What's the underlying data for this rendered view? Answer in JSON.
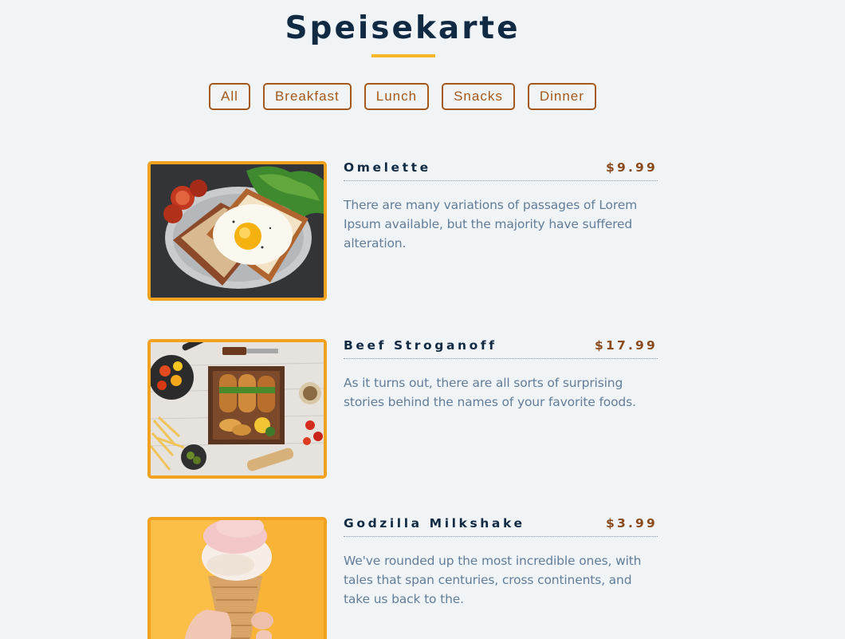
{
  "header": {
    "title": "Speisekarte"
  },
  "filters": [
    {
      "label": "All"
    },
    {
      "label": "Breakfast"
    },
    {
      "label": "Lunch"
    },
    {
      "label": "Snacks"
    },
    {
      "label": "Dinner"
    }
  ],
  "menu": [
    {
      "name": "Omelette",
      "price": "$9.99",
      "description": "There are many variations of passages of Lorem Ipsum available, but the majority have suffered alteration."
    },
    {
      "name": "Beef Stroganoff",
      "price": "$17.99",
      "description": "As it turns out, there are all sorts of surprising stories behind the names of your favorite foods."
    },
    {
      "name": "Godzilla Milkshake",
      "price": "$3.99",
      "description": "We've rounded up the most incredible ones, with tales that span centuries, cross continents, and take us back to the."
    }
  ],
  "colors": {
    "background": "#f1f4f7",
    "title": "#102a43",
    "accent": "#f7b626",
    "filter_border": "#a4581b",
    "price": "#8a4a1c",
    "description": "#617d98"
  }
}
